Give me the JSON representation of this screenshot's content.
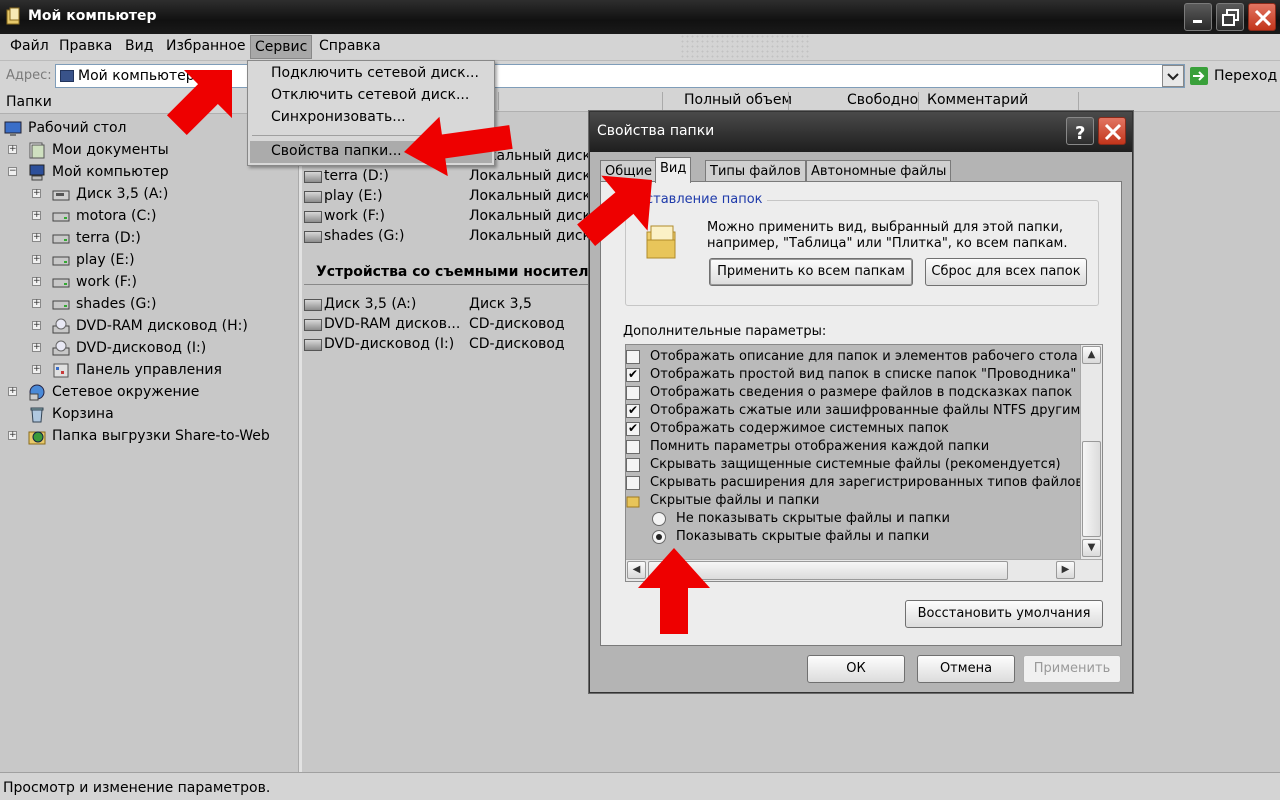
{
  "window": {
    "title": "Мой компьютер"
  },
  "menu": [
    "Файл",
    "Правка",
    "Вид",
    "Избранное",
    "Сервис",
    "Справка"
  ],
  "address": {
    "label": "Адрес:",
    "value": "Мой компьютер",
    "go": "Переход"
  },
  "folders_pane": {
    "title": "Папки"
  },
  "tree": [
    {
      "label": "Рабочий стол",
      "icon": "desktop-icon"
    },
    {
      "label": "Мои документы",
      "icon": "documents-icon"
    },
    {
      "label": "Мой компьютер",
      "icon": "computer-icon"
    },
    {
      "label": "Диск 3,5 (A:)",
      "icon": "floppy-icon"
    },
    {
      "label": "motora (C:)",
      "icon": "drive-icon"
    },
    {
      "label": "terra (D:)",
      "icon": "drive-icon"
    },
    {
      "label": "play (E:)",
      "icon": "drive-icon"
    },
    {
      "label": "work (F:)",
      "icon": "drive-icon"
    },
    {
      "label": "shades (G:)",
      "icon": "drive-icon"
    },
    {
      "label": "DVD-RAM дисковод (H:)",
      "icon": "cdrom-icon"
    },
    {
      "label": "DVD-дисковод (I:)",
      "icon": "cdrom-icon"
    },
    {
      "label": "Панель управления",
      "icon": "control-panel-icon"
    },
    {
      "label": "Сетевое окружение",
      "icon": "network-icon"
    },
    {
      "label": "Корзина",
      "icon": "recycle-bin-icon"
    },
    {
      "label": "Папка выгрузки Share-to-Web",
      "icon": "share-folder-icon"
    }
  ],
  "columns": [
    "Полный объем",
    "Свободно",
    "Комментарий"
  ],
  "drives": [
    {
      "name": "",
      "type": "Локальный диск"
    },
    {
      "name": "terra (D:)",
      "type": "Локальный диск"
    },
    {
      "name": "play (E:)",
      "type": "Локальный диск"
    },
    {
      "name": "work (F:)",
      "type": "Локальный диск"
    },
    {
      "name": "shades (G:)",
      "type": "Локальный диск"
    }
  ],
  "removable_group": "Устройства со съемными носителя",
  "removable": [
    {
      "name": "Диск 3,5 (A:)",
      "type": "Диск 3,5"
    },
    {
      "name": "DVD-RAM дисков...",
      "type": "CD-дисковод"
    },
    {
      "name": "DVD-дисковод (I:)",
      "type": "CD-дисковод"
    }
  ],
  "service_menu": {
    "items": [
      "Подключить сетевой диск...",
      "Отключить сетевой диск...",
      "Синхронизовать...",
      "Свойства папки..."
    ]
  },
  "status": "Просмотр и изменение параметров.",
  "dialog": {
    "title": "Свойства папки",
    "tabs": [
      "Общие",
      "Вид",
      "Типы файлов",
      "Автономные файлы"
    ],
    "group_title": "дставление папок",
    "group_text": "Можно применить вид, выбранный для этой папки, например, \"Таблица\" или \"Плитка\", ко всем папкам.",
    "apply_all": "Применить ко всем папкам",
    "reset_all": "Сброс для всех папок",
    "advanced_label": "Дополнительные параметры:",
    "options": [
      {
        "label": "Отображать описание для папок и элементов рабочего стола",
        "kind": "checkbox",
        "checked": false
      },
      {
        "label": "Отображать простой вид папок в списке папок \"Проводника\"",
        "kind": "checkbox",
        "checked": true
      },
      {
        "label": "Отображать сведения о размере файлов в подсказках папок",
        "kind": "checkbox",
        "checked": false
      },
      {
        "label": "Отображать сжатые или зашифрованные файлы NTFS другим",
        "kind": "checkbox",
        "checked": true
      },
      {
        "label": "Отображать содержимое системных папок",
        "kind": "checkbox",
        "checked": true
      },
      {
        "label": "Помнить параметры отображения каждой папки",
        "kind": "checkbox",
        "checked": false
      },
      {
        "label": "Скрывать защищенные системные файлы (рекомендуется)",
        "kind": "checkbox",
        "checked": false
      },
      {
        "label": "Скрывать расширения для зарегистрированных типов файлов",
        "kind": "checkbox",
        "checked": false
      },
      {
        "label": "Скрытые файлы и папки",
        "kind": "folder",
        "checked": false
      },
      {
        "label": "Не показывать скрытые файлы и папки",
        "kind": "radio",
        "checked": false
      },
      {
        "label": "Показывать скрытые файлы и папки",
        "kind": "radio",
        "checked": true
      }
    ],
    "restore": "Восстановить умолчания",
    "ok": "ОК",
    "cancel": "Отмена",
    "apply": "Применить"
  },
  "colors": {
    "arrow": "#ee0000"
  }
}
